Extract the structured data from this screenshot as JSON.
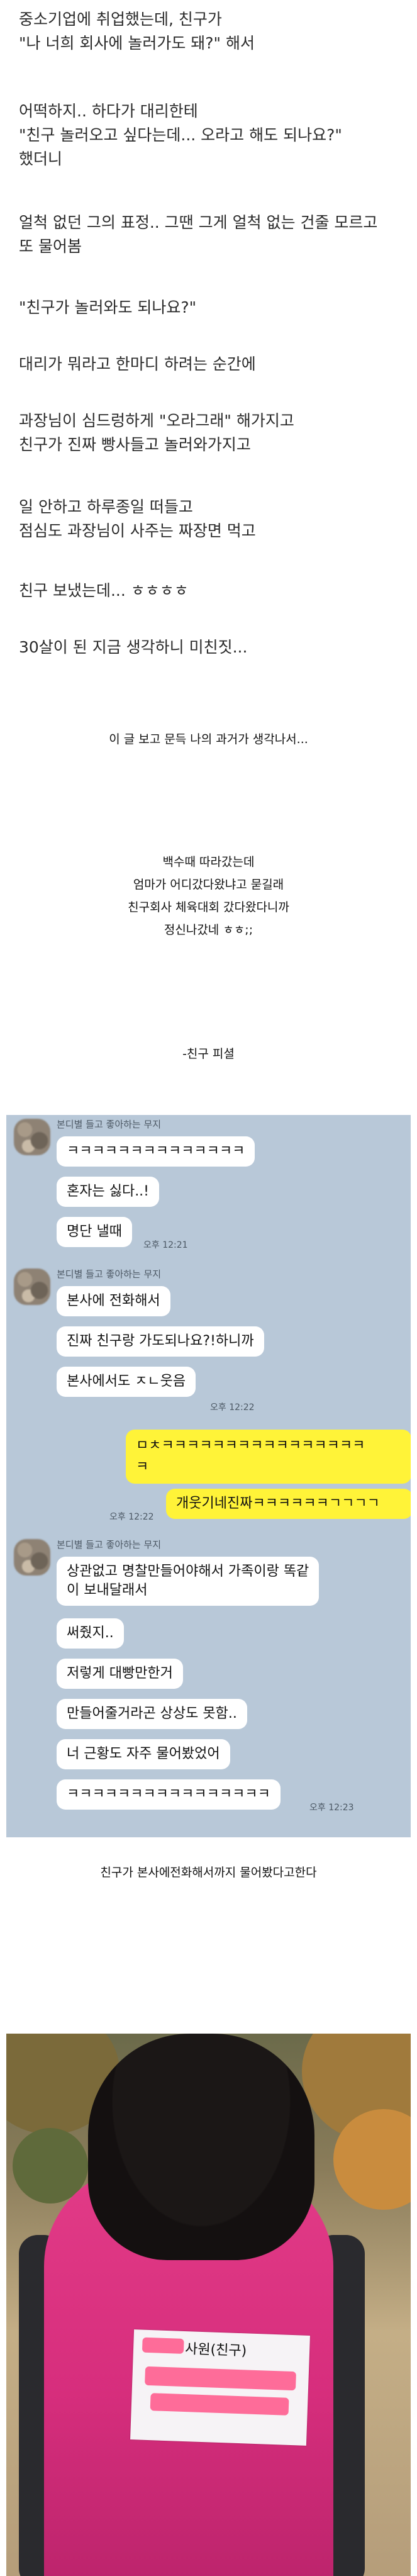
{
  "story": {
    "lines": [
      "중소기업에 취업했는데, 친구가\n\"나 너희 회사에 놀러가도 돼?\" 해서",
      "어떡하지.. 하다가 대리한테\n\"친구 놀러오고 싶다는데... 오라고 해도 되나요?\"\n했더니",
      "얼척 없던 그의 표정.. 그땐 그게 얼척 없는 건줄 모르고\n또 물어봄",
      "\"친구가 놀러와도 되나요?\"",
      "대리가 뭐라고 한마디 하려는 순간에",
      "과장님이 심드렁하게 \"오라그래\" 해가지고\n친구가 진짜 빵사들고 놀러와가지고",
      "일 안하고 하루종일 떠들고\n점심도 과장님이 사주는 짜장면 먹고",
      "친구 보냈는데... ㅎㅎㅎㅎ",
      "30살이 된 지금 생각하니 미친짓..."
    ]
  },
  "captions": {
    "c1": "이 글 보고 문득 나의 과거가 생각나서...",
    "c2": "백수때 따라갔는데\n엄마가 어디갔다왔냐고 묻길래\n친구회사 체육대회 갔다왔다니까\n정신나갔네 ㅎㅎ;;",
    "c3": "-친구 피셜",
    "c4": "친구가 본사에전화해서까지 물어봤다고한다"
  },
  "chat": {
    "sender": "본디별 들고 좋아하는 무지",
    "g1": [
      "ㅋㅋㅋㅋㅋㅋㅋㅋㅋㅋㅋㅋㅋㅋ",
      "혼자는 싫다..!",
      "명단 낼때"
    ],
    "g1_time": "오후 12:21",
    "g2": [
      "본사에 전화해서",
      "진짜 친구랑 가도되나요?!하니까",
      "본사에서도 ㅈㄴ웃음"
    ],
    "g2_time": "오후 12:22",
    "me1": "ㅁㅊㅋㅋㅋㅋㅋㅋㅋㅋㅋㅋㅋㅋㅋㅋㅋㅋ\nㅋ",
    "me2": "개웃기네진짜ㅋㅋㅋㅋㅋㅋㄱㄱㄱㄱ",
    "me_time": "오후 12:22",
    "g3": [
      "상관없고 명찰만들어야해서 가족이랑 똑같\n이 보내달래서",
      "써줬지..",
      "저렇게 대빵만한거",
      "만들어줄거라곤 상상도 못함..",
      "너 근황도 자주 물어봤었어",
      "ㅋㅋㅋㅋㅋㅋㅋㅋㅋㅋㅋㅋㅋㅋㅋㅋ"
    ],
    "g3_time": "오후 12:23"
  },
  "photo": {
    "nametag_text": "사원(친구)",
    "colors": {
      "vest": "#d72e7d",
      "bubble_me": "#fff338",
      "chat_bg": "#b8c8d8"
    }
  }
}
